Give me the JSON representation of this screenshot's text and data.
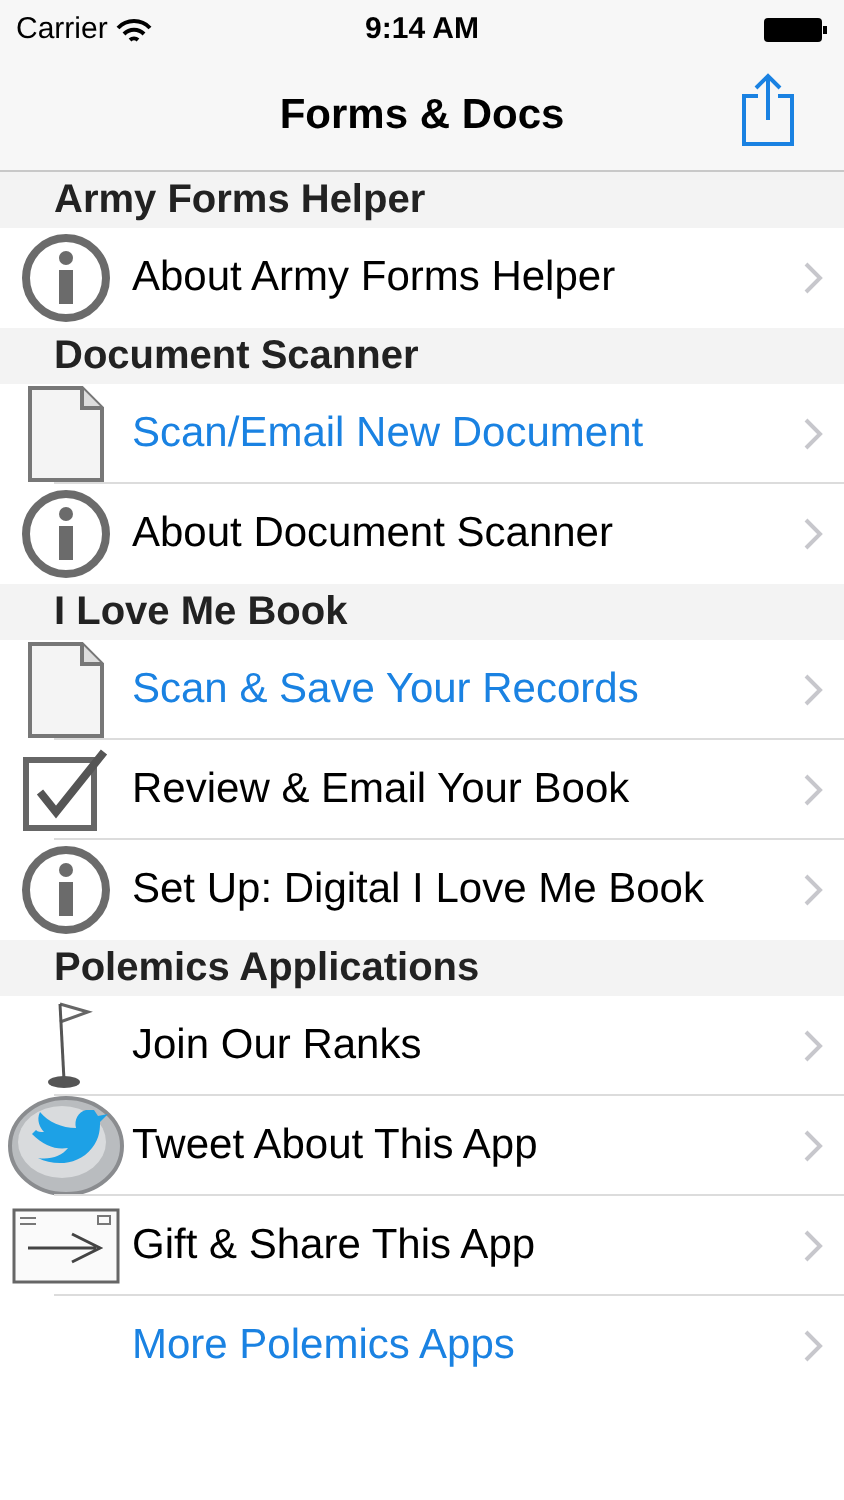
{
  "status_bar": {
    "carrier": "Carrier",
    "time": "9:14 AM"
  },
  "nav_bar": {
    "title": "Forms & Docs"
  },
  "sections": [
    {
      "title": "Army Forms Helper",
      "rows": [
        {
          "label": "About Army Forms Helper",
          "kind": "info",
          "color": "#000000"
        }
      ]
    },
    {
      "title": "Document Scanner",
      "rows": [
        {
          "label": "Scan/Email New Document",
          "kind": "document",
          "color": "#1a82e2"
        },
        {
          "label": "About Document Scanner",
          "kind": "info",
          "color": "#000000"
        }
      ]
    },
    {
      "title": "I Love Me Book",
      "rows": [
        {
          "label": "Scan & Save Your Records",
          "kind": "document",
          "color": "#1a82e2"
        },
        {
          "label": "Review & Email Your Book",
          "kind": "check",
          "color": "#000000"
        },
        {
          "label": "Set Up: Digital I Love Me Book",
          "kind": "info",
          "color": "#000000"
        }
      ]
    },
    {
      "title": "Polemics Applications",
      "rows": [
        {
          "label": "Join Our Ranks",
          "kind": "flag",
          "color": "#000000"
        },
        {
          "label": "Tweet About This App",
          "kind": "bird",
          "color": "#000000"
        },
        {
          "label": "Gift & Share This App",
          "kind": "envelope",
          "color": "#000000"
        },
        {
          "label": "More Polemics Apps",
          "kind": "none",
          "color": "#1a82e2"
        }
      ]
    }
  ]
}
